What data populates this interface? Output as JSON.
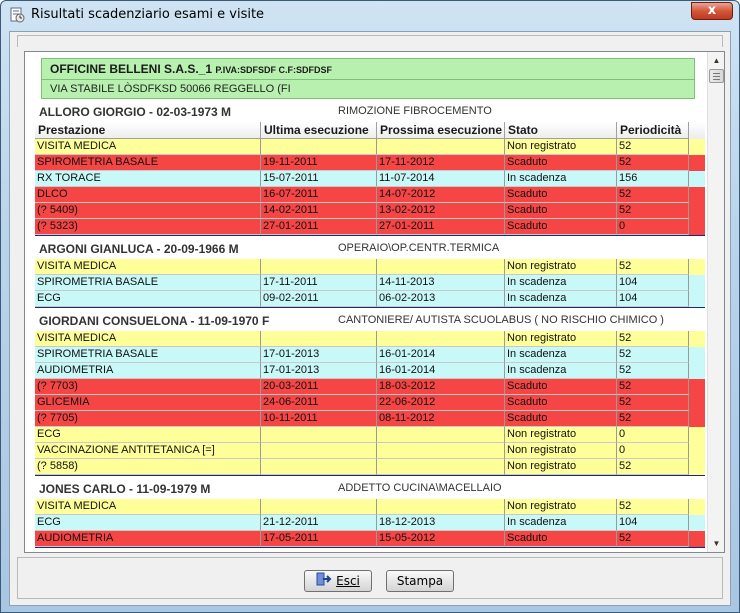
{
  "window": {
    "title": "Risultati scadenziario esami e visite",
    "close_label": "x"
  },
  "company": {
    "name": "OFFICINE BELLENI S.A.S._1",
    "tax": "P.IVA:SDFSDF C.F:SDFDSF",
    "address": "VIA STABILE LÒSDFKSD 50066 REGGELLO (FI"
  },
  "columns": [
    "Prestazione",
    "Ultima esecuzione",
    "Prossima esecuzione",
    "Stato",
    "Periodicità"
  ],
  "people": [
    {
      "name": "ALLORO GIORGIO - 02-03-1973 M",
      "job": "RIMOZIONE FIBROCEMENTO",
      "rows": [
        {
          "cells": [
            "VISITA MEDICA",
            "",
            "",
            "Non registrato",
            "52"
          ],
          "status": "yellow"
        },
        {
          "cells": [
            "SPIROMETRIA BASALE",
            "19-11-2011",
            "17-11-2012",
            "Scaduto",
            "52"
          ],
          "status": "red"
        },
        {
          "cells": [
            "RX TORACE",
            "15-07-2011",
            "11-07-2014",
            "In scadenza",
            "156"
          ],
          "status": "cyan"
        },
        {
          "cells": [
            "DLCO",
            "16-07-2011",
            "14-07-2012",
            "Scaduto",
            "52"
          ],
          "status": "red"
        },
        {
          "cells": [
            "(? 5409)",
            "14-02-2011",
            "13-02-2012",
            "Scaduto",
            "52"
          ],
          "status": "red"
        },
        {
          "cells": [
            "(? 5323)",
            "27-01-2011",
            "27-01-2011",
            "Scaduto",
            "0"
          ],
          "status": "red"
        }
      ]
    },
    {
      "name": "ARGONI GIANLUCA - 20-09-1966 M",
      "job": "OPERAIO\\OP.CENTR.TERMICA",
      "rows": [
        {
          "cells": [
            "VISITA MEDICA",
            "",
            "",
            "Non registrato",
            "52"
          ],
          "status": "yellow"
        },
        {
          "cells": [
            "SPIROMETRIA BASALE",
            "17-11-2011",
            "14-11-2013",
            "In scadenza",
            "104"
          ],
          "status": "cyan"
        },
        {
          "cells": [
            "ECG",
            "09-02-2011",
            "06-02-2013",
            "In scadenza",
            "104"
          ],
          "status": "cyan"
        }
      ]
    },
    {
      "name": "GIORDANI CONSUELONA - 11-09-1970 F",
      "job": "CANTONIERE/ AUTISTA SCUOLABUS ( NO RISCHIO CHIMICO )",
      "rows": [
        {
          "cells": [
            "VISITA MEDICA",
            "",
            "",
            "Non registrato",
            "52"
          ],
          "status": "yellow"
        },
        {
          "cells": [
            "SPIROMETRIA BASALE",
            "17-01-2013",
            "16-01-2014",
            "In scadenza",
            "52"
          ],
          "status": "cyan"
        },
        {
          "cells": [
            "AUDIOMETRIA",
            "17-01-2013",
            "16-01-2014",
            "In scadenza",
            "52"
          ],
          "status": "cyan"
        },
        {
          "cells": [
            "(? 7703)",
            "20-03-2011",
            "18-03-2012",
            "Scaduto",
            "52"
          ],
          "status": "red"
        },
        {
          "cells": [
            "GLICEMIA",
            "24-06-2011",
            "22-06-2012",
            "Scaduto",
            "52"
          ],
          "status": "red"
        },
        {
          "cells": [
            "(? 7705)",
            "10-11-2011",
            "08-11-2012",
            "Scaduto",
            "52"
          ],
          "status": "red"
        },
        {
          "cells": [
            "ECG",
            "",
            "",
            "Non registrato",
            "0"
          ],
          "status": "yellow"
        },
        {
          "cells": [
            "VACCINAZIONE ANTITETANICA [=]",
            "",
            "",
            "Non registrato",
            "0"
          ],
          "status": "yellow"
        },
        {
          "cells": [
            "(? 5858)",
            "",
            "",
            "Non registrato",
            "52"
          ],
          "status": "yellow"
        }
      ]
    },
    {
      "name": "JONES CARLO - 11-09-1979 M",
      "job": "ADDETTO CUCINA\\MACELLAIO",
      "rows": [
        {
          "cells": [
            "VISITA MEDICA",
            "",
            "",
            "Non registrato",
            "52"
          ],
          "status": "yellow"
        },
        {
          "cells": [
            "ECG",
            "21-12-2011",
            "18-12-2013",
            "In scadenza",
            "104"
          ],
          "status": "cyan"
        },
        {
          "cells": [
            "AUDIOMETRIA",
            "17-05-2011",
            "15-05-2012",
            "Scaduto",
            "52"
          ],
          "status": "red"
        }
      ]
    }
  ],
  "buttons": {
    "exit": "Esci",
    "print": "Stampa"
  },
  "status_colors": {
    "yellow": "#ffff99",
    "red": "#f64545",
    "cyan": "#c8f8f8"
  },
  "icons": [
    "app-icon",
    "exit-door-icon",
    "scroll-up-icon",
    "scroll-down-icon"
  ]
}
